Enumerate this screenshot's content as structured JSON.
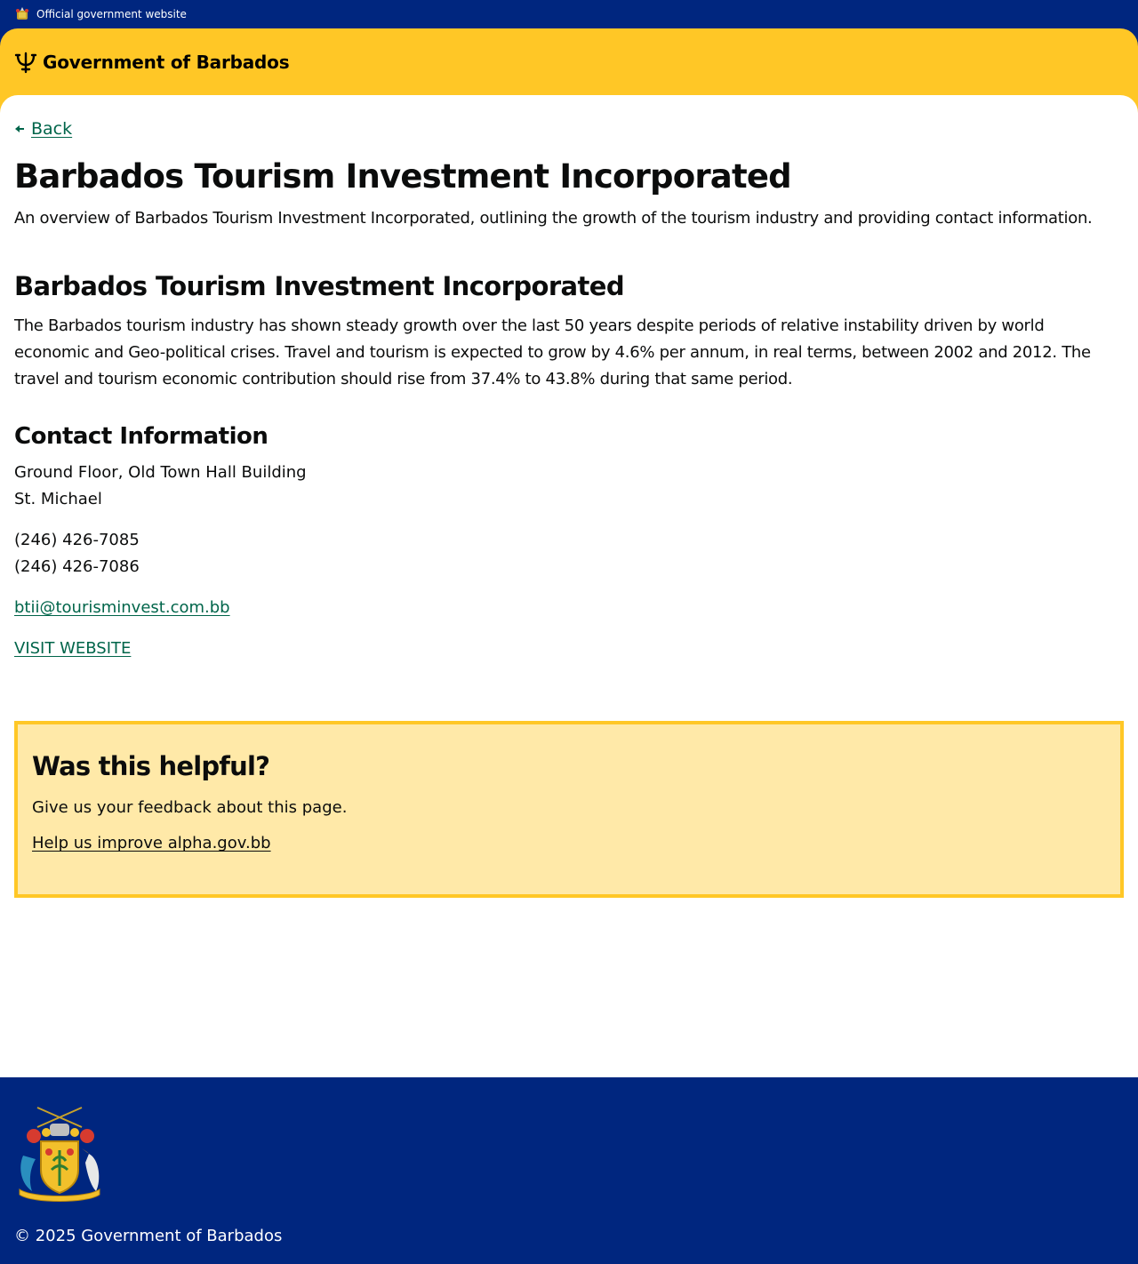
{
  "topbar": {
    "label": "Official government website"
  },
  "header": {
    "brand": "Government of Barbados",
    "logo_icon": "trident-icon"
  },
  "nav": {
    "back_label": "Back"
  },
  "page": {
    "title": "Barbados Tourism Investment Incorporated",
    "lead": "An overview of Barbados Tourism Investment Incorporated, outlining the growth of the tourism industry and providing contact information."
  },
  "section": {
    "heading": "Barbados Tourism Investment Incorporated",
    "body": "The Barbados tourism industry has shown steady growth over the last 50 years despite periods of relative instability driven by world economic and Geo-political crises. Travel and tourism is expected to grow by 4.6% per annum, in real terms, between 2002 and 2012. The travel and tourism economic contribution should rise from 37.4% to 43.8% during that same period."
  },
  "contact": {
    "heading": "Contact Information",
    "address_line1": "Ground Floor, Old Town Hall Building",
    "address_line2": "St. Michael",
    "phone1": "(246) 426-7085",
    "phone2": "(246) 426-7086",
    "email": "btii@tourisminvest.com.bb",
    "website_label": "VISIT WEBSITE"
  },
  "feedback": {
    "heading": "Was this helpful?",
    "text": "Give us your feedback about this page.",
    "link_label": "Help us improve alpha.gov.bb"
  },
  "footer": {
    "copyright": "© 2025 Government of Barbados"
  },
  "colors": {
    "navy": "#00267f",
    "gold": "#ffc726",
    "feedback_bg": "#ffe9a8",
    "link_green": "#00654a"
  }
}
